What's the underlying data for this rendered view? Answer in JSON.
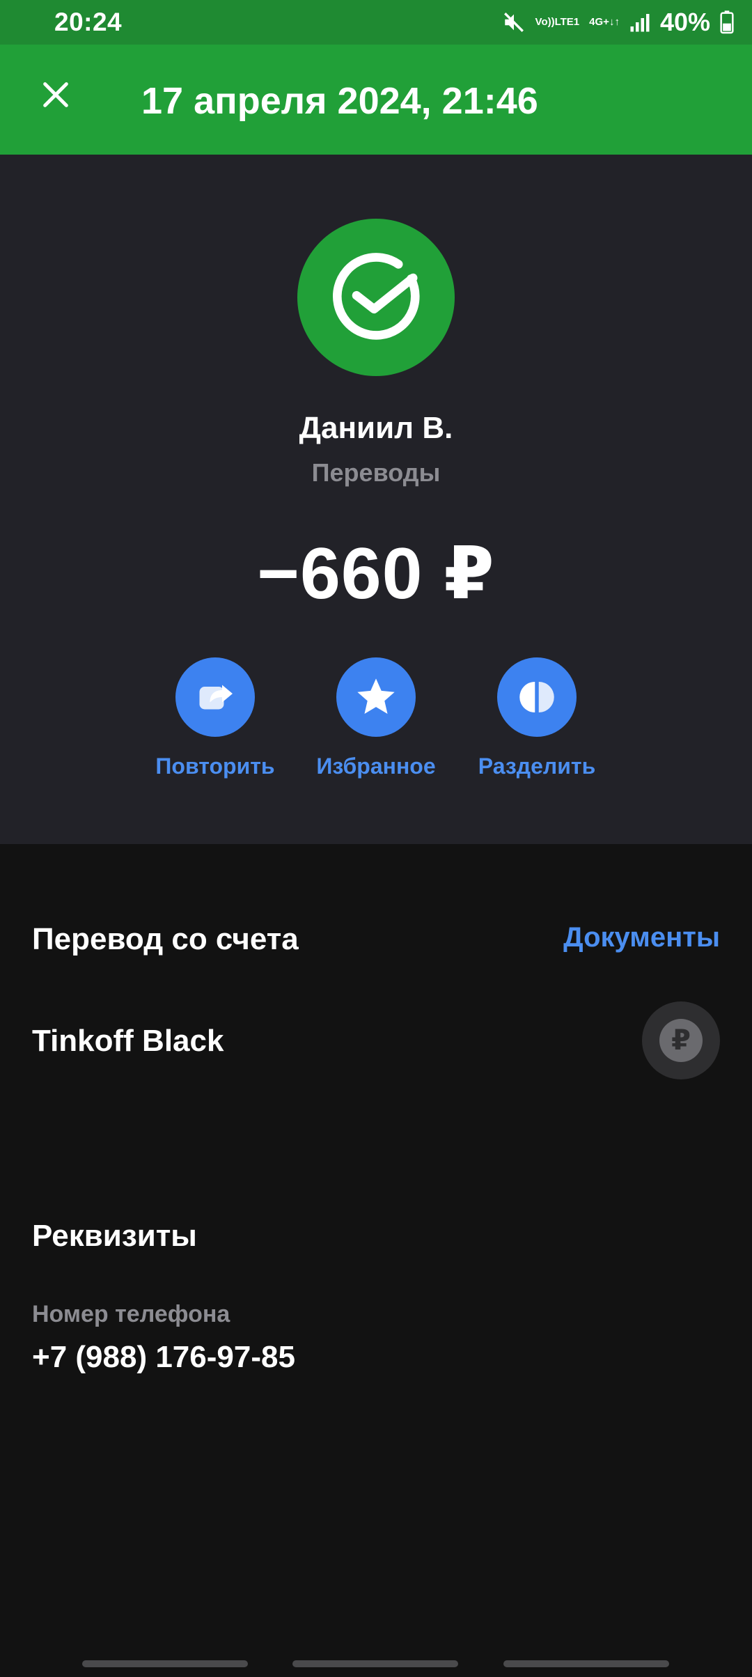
{
  "status_bar": {
    "time": "20:24",
    "network_top": "Vo))",
    "network_bottom": "LTE1",
    "data_top": "4G+",
    "battery": "40%",
    "icons": [
      "mute-icon",
      "signal-icon",
      "battery-icon"
    ]
  },
  "header": {
    "title": "17 апреля 2024, 21:46",
    "close_icon": "close-icon"
  },
  "summary": {
    "logo_icon": "sber-logo-icon",
    "recipient": "Даниил В.",
    "category": "Переводы",
    "amount": "−660 ₽",
    "actions": [
      {
        "label": "Повторить",
        "icon": "repeat-icon"
      },
      {
        "label": "Избранное",
        "icon": "star-icon"
      },
      {
        "label": "Разделить",
        "icon": "split-icon"
      }
    ]
  },
  "source": {
    "title": "Перевод со счета",
    "documents_link": "Документы",
    "account_name": "Tinkoff Black",
    "account_icon_symbol": "₽"
  },
  "details": {
    "title": "Реквизиты",
    "phone_label": "Номер телефона",
    "phone_value": "+7 (988) 176-97-85"
  },
  "colors": {
    "status_bar": "#1f8a32",
    "header": "#21a038",
    "panel": "#222228",
    "background": "#121212",
    "accent_blue": "#3d82f0",
    "link_blue": "#4b8ef0",
    "muted_text": "#8c8c92"
  }
}
